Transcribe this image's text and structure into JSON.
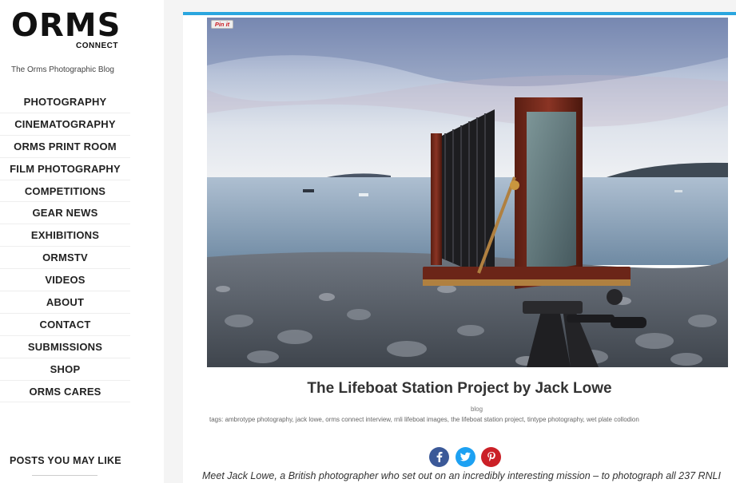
{
  "site": {
    "logo_main": "ORMS",
    "logo_sub": "CONNECT",
    "tagline": "The Orms Photographic Blog"
  },
  "nav": {
    "items": [
      {
        "label": "PHOTOGRAPHY"
      },
      {
        "label": "CINEMATOGRAPHY"
      },
      {
        "label": "ORMS PRINT ROOM"
      },
      {
        "label": "FILM PHOTOGRAPHY"
      },
      {
        "label": "COMPETITIONS"
      },
      {
        "label": "GEAR NEWS"
      },
      {
        "label": "EXHIBITIONS"
      },
      {
        "label": "ORMSTV"
      },
      {
        "label": "VIDEOS"
      },
      {
        "label": "ABOUT"
      },
      {
        "label": "CONTACT"
      },
      {
        "label": "SUBMISSIONS"
      },
      {
        "label": "SHOP"
      },
      {
        "label": "ORMS CARES"
      }
    ]
  },
  "sidebar": {
    "posts_title": "POSTS YOU MAY LIKE"
  },
  "post": {
    "pin_label": "Pin it",
    "title": "The Lifeboat Station Project by Jack Lowe",
    "category": "blog",
    "tags": "tags: ambrotype photography, jack lowe, orms connect interview, rnli lifeboat images, the lifeboat station project, tintype photography, wet plate collodion",
    "excerpt": "Meet Jack Lowe, a British photographer who set out on an incredibly interesting mission – to photograph all 237 RNLI"
  },
  "share": {
    "facebook_icon": "facebook-icon",
    "twitter_icon": "twitter-icon",
    "pinterest_icon": "pinterest-icon"
  },
  "colors": {
    "accent": "#2aa6df",
    "facebook": "#3b5998",
    "twitter": "#1da1f2",
    "pinterest": "#cb2027"
  }
}
